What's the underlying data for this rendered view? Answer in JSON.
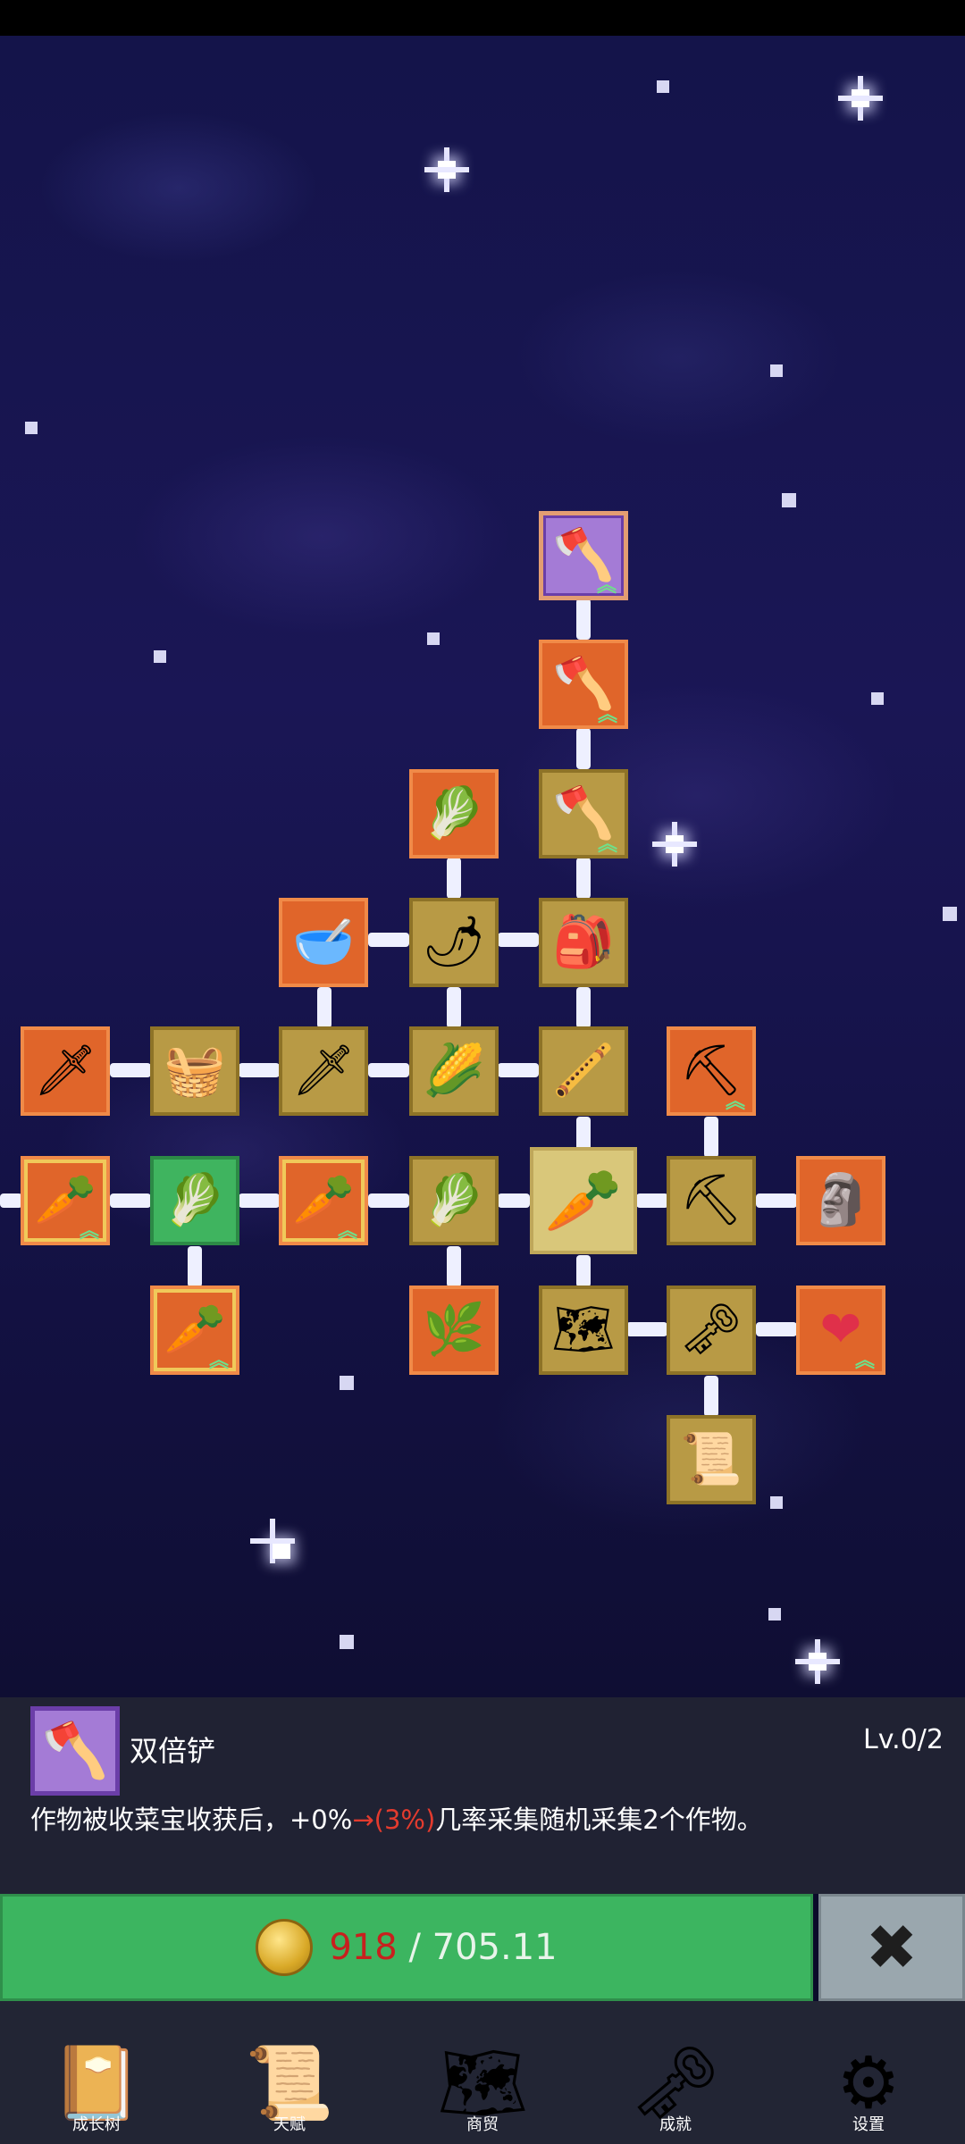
{
  "skill_tree": {
    "nodes": [
      {
        "id": "double-shovel-node",
        "icon": "shovel-icon",
        "style": "purple",
        "glyph": "🪓",
        "upgrade": true
      },
      {
        "id": "shovel-node-2",
        "icon": "shovel-icon",
        "style": "orange",
        "glyph": "🪓",
        "upgrade": true
      },
      {
        "id": "radish-node",
        "icon": "radish-icon",
        "style": "orange",
        "glyph": "🥬",
        "upgrade": false
      },
      {
        "id": "shovel-node-3",
        "icon": "shovel-icon",
        "style": "gold",
        "glyph": "🪓",
        "upgrade": true
      },
      {
        "id": "bowl-node",
        "icon": "bowl-icon",
        "style": "orange",
        "glyph": "🥣",
        "upgrade": false
      },
      {
        "id": "chili-node",
        "icon": "chili-pepper-icon",
        "style": "gold",
        "glyph": "🌶",
        "upgrade": false
      },
      {
        "id": "sack-node",
        "icon": "sack-icon",
        "style": "gold",
        "glyph": "🎒",
        "upgrade": false
      },
      {
        "id": "sword-node-1",
        "icon": "sword-icon",
        "style": "orange",
        "glyph": "🗡",
        "upgrade": false
      },
      {
        "id": "chest-node",
        "icon": "chest-icon",
        "style": "gold",
        "glyph": "🧺",
        "upgrade": false
      },
      {
        "id": "sword-node-2",
        "icon": "sword-icon",
        "style": "gold",
        "glyph": "🗡",
        "upgrade": false
      },
      {
        "id": "corn-node",
        "icon": "corn-icon",
        "style": "gold",
        "glyph": "🌽",
        "upgrade": false
      },
      {
        "id": "flute-node",
        "icon": "flute-icon",
        "style": "gold",
        "glyph": "🪈",
        "upgrade": false
      },
      {
        "id": "pickaxe-node-1",
        "icon": "pickaxe-icon",
        "style": "orange",
        "glyph": "⛏",
        "upgrade": true
      },
      {
        "id": "carrot-node-1",
        "icon": "carrot-icon",
        "style": "orange frame",
        "glyph": "🥕",
        "upgrade": true
      },
      {
        "id": "cabbage-node-1",
        "icon": "cabbage-icon",
        "style": "green",
        "glyph": "🥬",
        "upgrade": false
      },
      {
        "id": "carrot-node-2",
        "icon": "carrot-icon",
        "style": "orange frame",
        "glyph": "🥕",
        "upgrade": true
      },
      {
        "id": "cabbage-node-2",
        "icon": "cabbage-icon",
        "style": "gold",
        "glyph": "🥬",
        "upgrade": false
      },
      {
        "id": "carrot-root-node",
        "icon": "carrot-icon",
        "style": "gold-light",
        "glyph": "🥕",
        "upgrade": false
      },
      {
        "id": "pickaxe-node-2",
        "icon": "pickaxe-icon",
        "style": "gold",
        "glyph": "⛏",
        "upgrade": false
      },
      {
        "id": "statue-node",
        "icon": "statue-icon",
        "style": "orange",
        "glyph": "🗿",
        "upgrade": false
      },
      {
        "id": "carrot-node-3",
        "icon": "carrot-icon",
        "style": "orange frame",
        "glyph": "🥕",
        "upgrade": true
      },
      {
        "id": "leek-node",
        "icon": "leek-icon",
        "style": "orange",
        "glyph": "🌿",
        "upgrade": false
      },
      {
        "id": "map-node",
        "icon": "map-icon",
        "style": "gold",
        "glyph": "🗺",
        "upgrade": false
      },
      {
        "id": "key-node",
        "icon": "key-icon",
        "style": "gold",
        "glyph": "🗝",
        "upgrade": false
      },
      {
        "id": "heart-node",
        "icon": "heart-icon",
        "style": "orange",
        "glyph": "❤",
        "upgrade": true
      },
      {
        "id": "scroll-node",
        "icon": "scroll-icon",
        "style": "gold",
        "glyph": "📜",
        "upgrade": false
      }
    ]
  },
  "detail": {
    "icon": "shovel-icon",
    "name": "双倍铲",
    "level": "Lv.0/2",
    "desc_before": "作物被收菜宝收获后，+0%",
    "desc_arrow": "→",
    "desc_highlight": "(3%)",
    "desc_after": "几率采集随机采集2个作物。"
  },
  "upgrade": {
    "icon": "coin-icon",
    "current": "918",
    "separator": " / ",
    "required": "705.11"
  },
  "close": {
    "icon": "close-icon"
  },
  "nav": {
    "items": [
      {
        "label": "成长树",
        "icon": "book-icon"
      },
      {
        "label": "天赋",
        "icon": "scroll-icon"
      },
      {
        "label": "商贸",
        "icon": "map-icon"
      },
      {
        "label": "成就",
        "icon": "key-icon"
      },
      {
        "label": "设置",
        "icon": "gear-icon"
      }
    ]
  },
  "colors": {
    "node_orange": "#e0652a",
    "node_gold": "#b89a45",
    "node_green": "#3fb45f",
    "node_purple": "#a47bd6",
    "upgrade_button": "#3cb560",
    "close_button": "#9aa7ae",
    "highlight_red": "#e33b2e"
  }
}
